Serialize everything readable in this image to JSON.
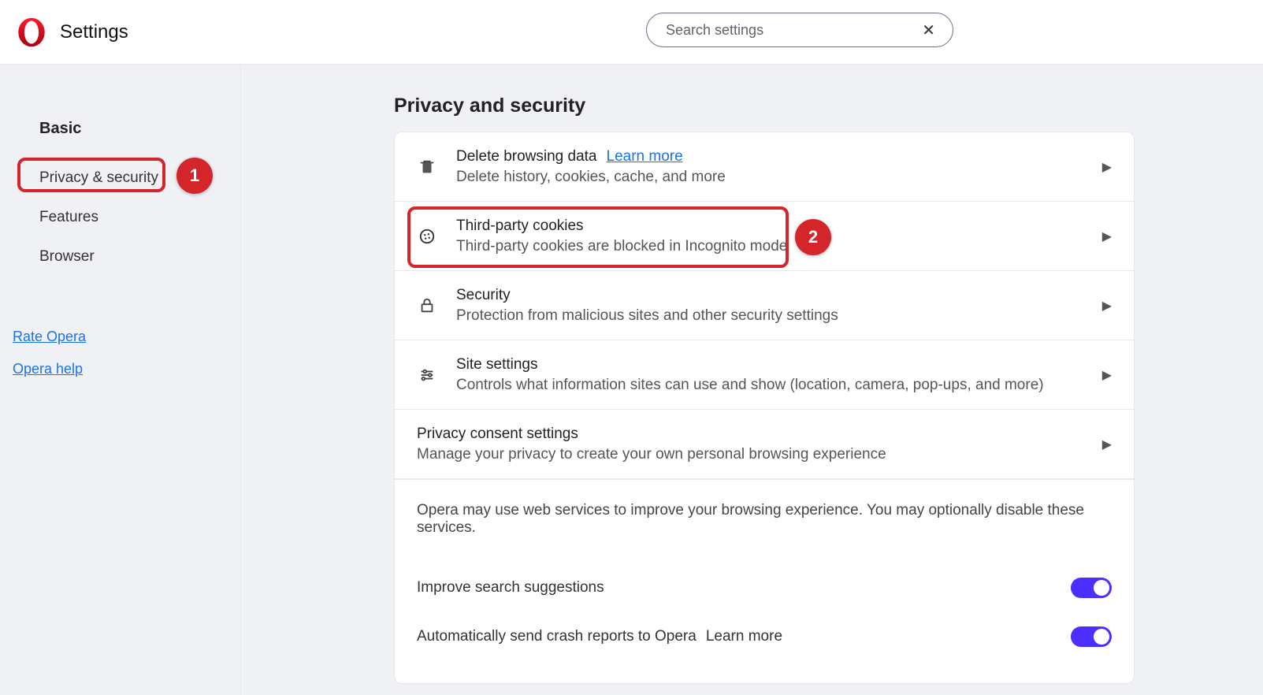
{
  "header": {
    "title": "Settings",
    "search_placeholder": "Search settings"
  },
  "sidebar": {
    "heading": "Basic",
    "items": [
      {
        "label": "Privacy & security"
      },
      {
        "label": "Features"
      },
      {
        "label": "Browser"
      }
    ],
    "links": [
      {
        "label": "Rate Opera"
      },
      {
        "label": "Opera help"
      }
    ]
  },
  "annotations": {
    "n1": "1",
    "n2": "2"
  },
  "main": {
    "section_title": "Privacy and security",
    "rows": [
      {
        "title": "Delete browsing data",
        "learn": "Learn more",
        "desc": "Delete history, cookies, cache, and more"
      },
      {
        "title": "Third-party cookies",
        "desc": "Third-party cookies are blocked in Incognito mode"
      },
      {
        "title": "Security",
        "desc": "Protection from malicious sites and other security settings"
      },
      {
        "title": "Site settings",
        "desc": "Controls what information sites can use and show (location, camera, pop-ups, and more)"
      },
      {
        "title": "Privacy consent settings",
        "desc": "Manage your privacy to create your own personal browsing experience"
      }
    ],
    "info": "Opera may use web services to improve your browsing experience. You may optionally disable these services.",
    "toggles": [
      {
        "label": "Improve search suggestions",
        "on": true
      },
      {
        "label": "Automatically send crash reports to Opera",
        "learn": "Learn more",
        "on": true
      }
    ]
  }
}
